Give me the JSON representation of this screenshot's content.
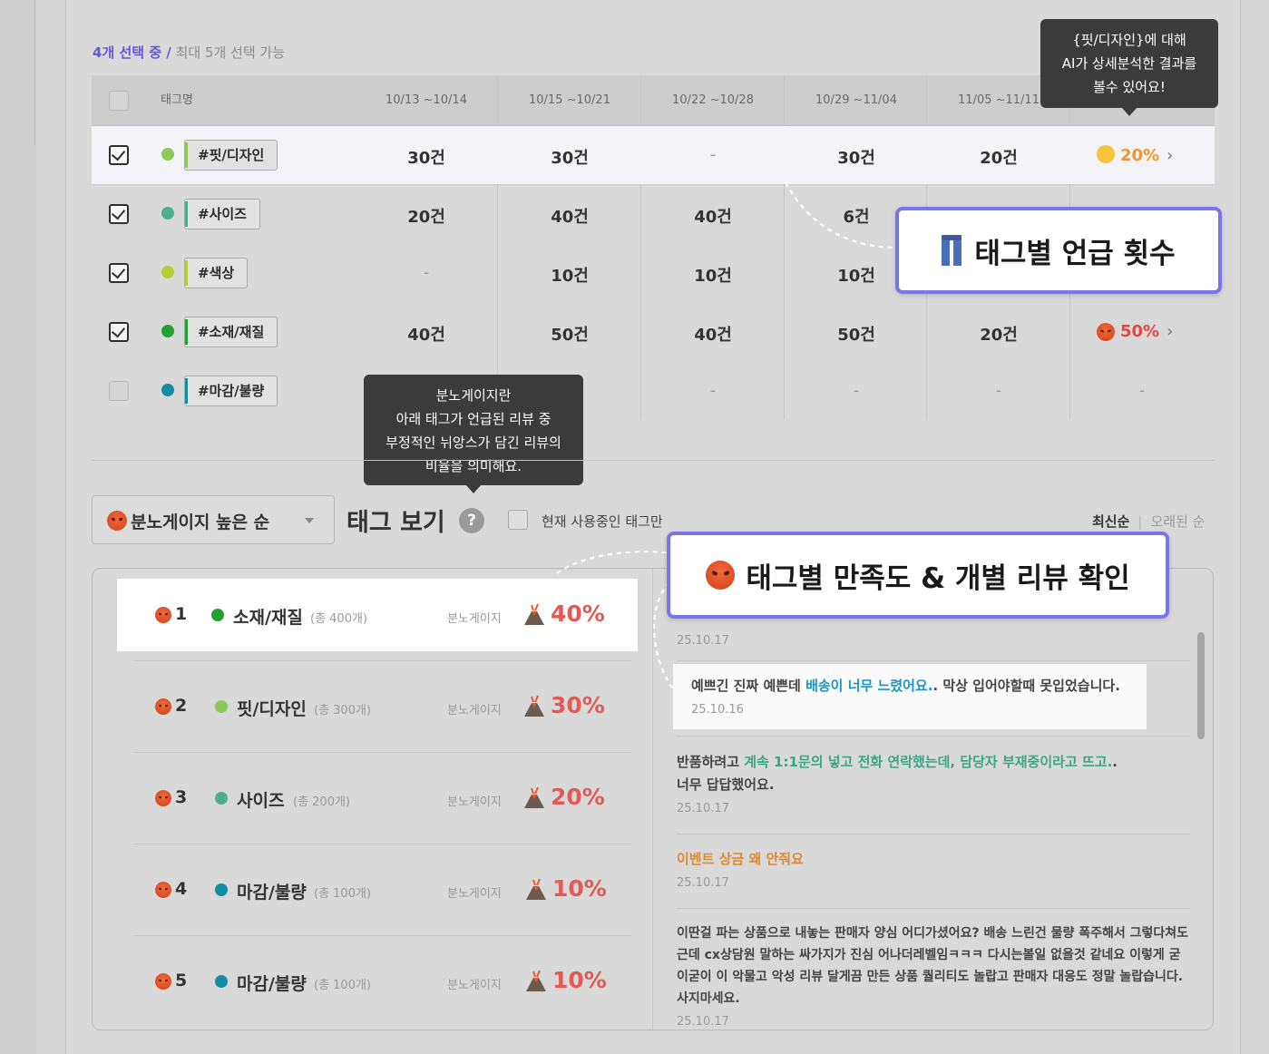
{
  "selection": {
    "highlight": "4개 선택 중 /",
    "rest": " 최대 5개 선택 가능"
  },
  "table": {
    "headers": [
      "태그명",
      "10/13 ~10/14",
      "10/15 ~10/21",
      "10/22 ~10/28",
      "10/29 ~11/04",
      "11/05 ~11/11"
    ],
    "rows": [
      {
        "tag": "#핏/디자인",
        "color": "#8dc85a",
        "checked": true,
        "cells": [
          "30건",
          "30건",
          "-",
          "30건",
          "20건"
        ],
        "rate": "20%",
        "rate_color": "#f0942c"
      },
      {
        "tag": "#사이즈",
        "color": "#4fae8e",
        "checked": true,
        "cells": [
          "20건",
          "40건",
          "40건",
          "6건",
          ""
        ],
        "rate": "",
        "rate_color": ""
      },
      {
        "tag": "#색상",
        "color": "#b4cf3a",
        "checked": true,
        "cells": [
          "-",
          "10건",
          "10건",
          "10건",
          ""
        ],
        "rate": "",
        "rate_color": ""
      },
      {
        "tag": "#소재/재질",
        "color": "#24a033",
        "checked": true,
        "cells": [
          "40건",
          "50건",
          "40건",
          "50건",
          "20건"
        ],
        "rate": "50%",
        "rate_color": "#e04848"
      },
      {
        "tag": "#마감/불량",
        "color": "#138da5",
        "checked": false,
        "cells": [
          "",
          "",
          "-",
          "-",
          "-"
        ],
        "rate": "-",
        "rate_color": "#9a9a9a"
      }
    ]
  },
  "tooltip_ai": {
    "line1": "{핏/디자인}에 대해",
    "line2": "AI가 상세분석한 결과를",
    "line3": "볼수 있어요!"
  },
  "tooltip_gauge": {
    "line1": "분노게이지란",
    "line2": "아래 태그가 언급된 리뷰 중",
    "line3": "부정적인 뉘앙스가 담긴 리뷰의",
    "line4": "비율을 의미해요."
  },
  "callout_mentions": "태그별 언급 횟수",
  "callout_satisfaction": "태그별 만족도 & 개별 리뷰 확인",
  "controls": {
    "dropdown_label": "분노게이지 높은 순",
    "tagview_title": "태그 보기",
    "help_glyph": "?",
    "only_current_label": "현재 사용중인 태그만",
    "sort_latest": "최신순",
    "sort_divider": "|",
    "sort_oldest": "오래된 순"
  },
  "ranking": [
    {
      "num": "1",
      "name": "소재/재질",
      "total": "(총 400개)",
      "gauge_label": "분노게이지",
      "pct": "40%",
      "color": "#24a033"
    },
    {
      "num": "2",
      "name": "핏/디자인",
      "total": "(총 300개)",
      "gauge_label": "분노게이지",
      "pct": "30%",
      "color": "#8dc85a"
    },
    {
      "num": "3",
      "name": "사이즈",
      "total": "(총 200개)",
      "gauge_label": "분노게이지",
      "pct": "20%",
      "color": "#4fae8e"
    },
    {
      "num": "4",
      "name": "마감/불량",
      "total": "(총 100개)",
      "gauge_label": "분노게이지",
      "pct": "10%",
      "color": "#138da5"
    },
    {
      "num": "5",
      "name": "마감/불량",
      "total": "(총 100개)",
      "gauge_label": "분노게이지",
      "pct": "10%",
      "color": "#138da5"
    }
  ],
  "reviews": [
    {
      "date": "25.10.17"
    },
    {
      "pre": "예쁘긴 진짜 예쁜데 ",
      "hl": "배송이 너무 느렸어요.",
      "post": ". 막상 입어야할때 못입었습니다.",
      "date": "25.10.16"
    },
    {
      "pre": "반품하려고 ",
      "hl": "계속 1:1문의 넣고 전화 연락했는데, 담당자 부재중이라고 뜨고.",
      "post": ".",
      "line2": "너무 답답했어요.",
      "date": "25.10.17"
    },
    {
      "hl": "이벤트 상금 왜 안줘요",
      "date": "25.10.17"
    },
    {
      "text": "이딴걸 파는 상품으로 내놓는 판매자 양심 어디가셨어요? 배송 느린건 물량 폭주해서 그렇다쳐도 근데 cx상담원 말하는 싸가지가 진심 어나더레벨임ㅋㅋㅋ 다시는볼일 없을것 같네요 이렇게 굳이굳이 이 악물고 악성 리뷰 달게끔 만든 상품 퀄리티도 놀랍고 판매자 대응도 정말 놀랍습니다. 사지마세요.",
      "date": "25.10.17"
    }
  ]
}
